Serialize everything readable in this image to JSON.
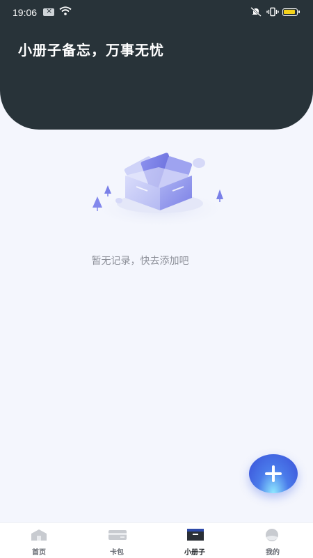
{
  "status_bar": {
    "time": "19:06",
    "icons": [
      "notification-icon",
      "wifi-icon",
      "mute-icon",
      "vibrate-icon",
      "battery-icon"
    ],
    "battery_color": "#f4d21b"
  },
  "header": {
    "title": "小册子备忘，万事无忧",
    "background": "#283339"
  },
  "main": {
    "empty_message": "暂无记录，快去添加吧",
    "illustration": "empty-box-illustration"
  },
  "fab": {
    "icon": "plus-icon",
    "accent": "#3a4fd8"
  },
  "bottom_nav": {
    "active_index": 2,
    "items": [
      {
        "label": "首页",
        "icon": "home-icon"
      },
      {
        "label": "卡包",
        "icon": "card-wallet-icon"
      },
      {
        "label": "小册子",
        "icon": "booklet-icon"
      },
      {
        "label": "我的",
        "icon": "profile-icon"
      }
    ]
  }
}
